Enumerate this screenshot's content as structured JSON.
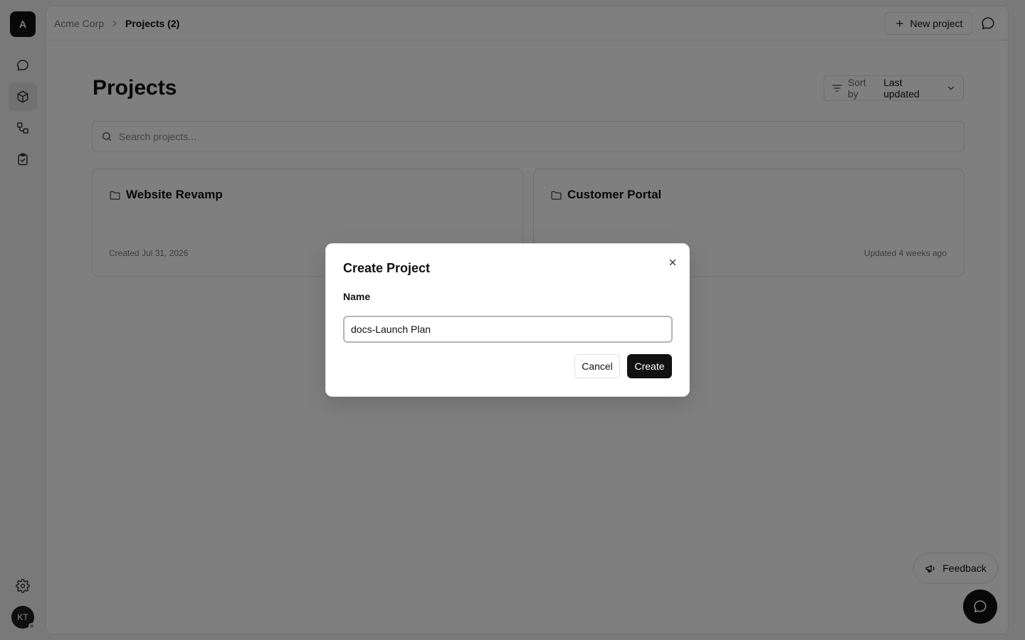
{
  "sidebar": {
    "org_initial": "A",
    "nav_items": [
      {
        "name": "chat",
        "icon": "chat-bubble-icon",
        "active": false
      },
      {
        "name": "projects",
        "icon": "cube-icon",
        "active": true
      },
      {
        "name": "workflows",
        "icon": "workflow-icon",
        "active": false
      },
      {
        "name": "tasks",
        "icon": "clipboard-check-icon",
        "active": false
      }
    ],
    "settings_icon": "gear-icon",
    "user_initials": "KT"
  },
  "header": {
    "breadcrumb": {
      "org": "Acme Corp",
      "current": "Projects (2)"
    },
    "new_project_label": "New project",
    "search_icon": "search-icon"
  },
  "main": {
    "title": "Projects",
    "sort": {
      "label": "Sort by",
      "value": "Last updated"
    },
    "search": {
      "placeholder": "Search projects..."
    },
    "projects": [
      {
        "name": "Website Revamp",
        "meta": "Created Jul 31, 2026"
      },
      {
        "name": "Customer Portal",
        "meta": "Updated 4 weeks ago"
      }
    ],
    "feedback_label": "Feedback"
  },
  "modal": {
    "title": "Create Project",
    "name_label": "Name",
    "name_value": "docs-Launch Plan",
    "cancel_label": "Cancel",
    "create_label": "Create"
  },
  "colors": {
    "primary": "#111111",
    "overlay": "rgba(0,0,0,0.5)",
    "muted_text": "#777777"
  }
}
